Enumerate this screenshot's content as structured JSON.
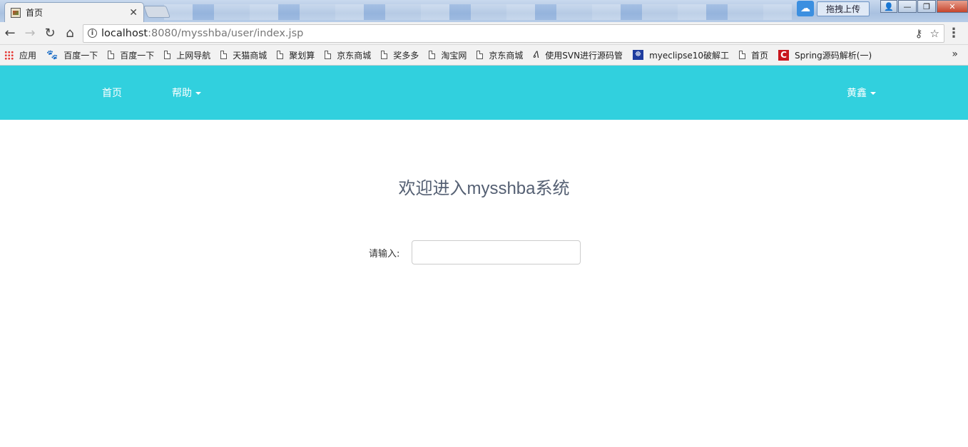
{
  "browser": {
    "tab": {
      "title": "首页",
      "close_glyph": "✕",
      "favicon": "page-favicon-icon"
    },
    "window_controls": {
      "upload_label": "拖拽上传",
      "minimize": "—",
      "maximize": "❐",
      "close": "✕"
    },
    "address": {
      "host": "localhost",
      "rest": ":8080/mysshba/user/index.jsp"
    },
    "bookmarks": [
      {
        "label": "应用",
        "icon": "apps-grid-icon"
      },
      {
        "label": "百度一下",
        "icon": "baidu-paw-icon"
      },
      {
        "label": "百度一下",
        "icon": "page-icon"
      },
      {
        "label": "上网导航",
        "icon": "page-icon"
      },
      {
        "label": "天猫商城",
        "icon": "page-icon"
      },
      {
        "label": "聚划算",
        "icon": "page-icon"
      },
      {
        "label": "京东商城",
        "icon": "page-icon"
      },
      {
        "label": "奖多多",
        "icon": "page-icon"
      },
      {
        "label": "淘宝网",
        "icon": "page-icon"
      },
      {
        "label": "京东商城",
        "icon": "page-icon"
      },
      {
        "label": "使用SVN进行源码管",
        "icon": "svn-icon"
      },
      {
        "label": "myeclipse10破解工",
        "icon": "myeclipse-icon"
      },
      {
        "label": "首页",
        "icon": "page-icon"
      },
      {
        "label": "Spring源码解析(一)",
        "icon": "csdn-icon"
      }
    ],
    "bookmarks_more": "»"
  },
  "navbar": {
    "home": "首页",
    "help": "帮助",
    "user": "黄鑫",
    "color": "#31d0de"
  },
  "main": {
    "welcome": "欢迎进入mysshba系统",
    "input_label": "请输入:",
    "input_value": ""
  }
}
